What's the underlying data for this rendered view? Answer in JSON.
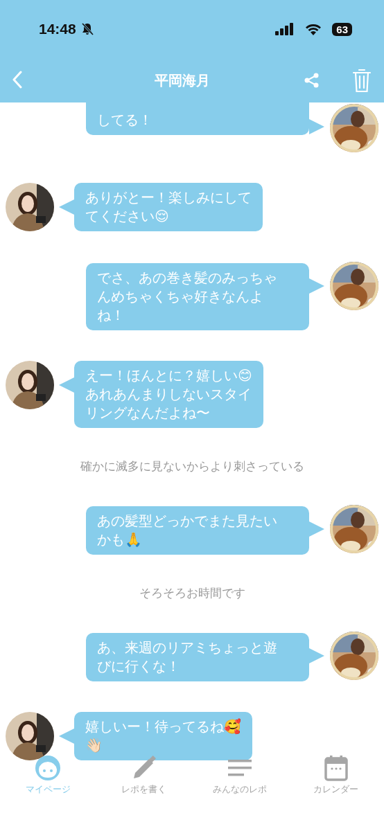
{
  "status_bar": {
    "time": "14:48",
    "battery": "63"
  },
  "header": {
    "title": "平岡海月"
  },
  "messages": [
    {
      "kind": "sent",
      "lines": [
        "してる！"
      ]
    },
    {
      "kind": "received",
      "lines": [
        "ありがとー！楽しみにして",
        "てください😌"
      ]
    },
    {
      "kind": "sent",
      "lines": [
        "でさ、あの巻き髪のみっちゃ",
        "んめちゃくちゃ好きなんよ",
        "ね！"
      ]
    },
    {
      "kind": "received",
      "lines": [
        "えー！ほんとに？嬉しい😊",
        "あれあんまりしないスタイ",
        "リングなんだよね〜"
      ]
    },
    {
      "kind": "note",
      "lines": [
        "確かに滅多に見ないからより刺さっている"
      ]
    },
    {
      "kind": "sent",
      "lines": [
        "あの髪型どっかでまた見たい",
        "かも🙏"
      ]
    },
    {
      "kind": "note",
      "lines": [
        "そろそろお時間です"
      ]
    },
    {
      "kind": "sent",
      "lines": [
        "あ、来週のリアミちょっと遊",
        "びに行くな！"
      ]
    },
    {
      "kind": "received",
      "lines": [
        "嬉しいー！待ってるね🥰",
        "👋🏻"
      ]
    }
  ],
  "tabs": [
    {
      "kind": "person",
      "label": "マイページ",
      "selected": true
    },
    {
      "kind": "pencil",
      "label": "レポを書く",
      "selected": false
    },
    {
      "kind": "list",
      "label": "みんなのレポ",
      "selected": false
    },
    {
      "kind": "calendar",
      "label": "カレンダー",
      "selected": false
    }
  ]
}
